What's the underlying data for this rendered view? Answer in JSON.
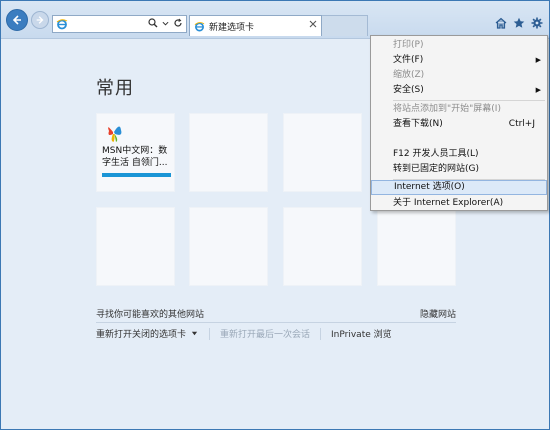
{
  "tab": {
    "title": "新建选项卡"
  },
  "page": {
    "heading": "常用"
  },
  "tiles": [
    {
      "title": "MSN中文网：数字生活 自领门..."
    }
  ],
  "links": {
    "find_sites": "寻找你可能喜欢的其他网站",
    "hide_sites": "隐藏网站",
    "reopen_tabs": "重新打开关闭的选项卡",
    "reopen_session": "重新打开最后一次会话",
    "inprivate": "InPrivate 浏览"
  },
  "menu": {
    "items": [
      {
        "label": "打印(P)",
        "disabled": true
      },
      {
        "label": "文件(F)",
        "submenu": true
      },
      {
        "label": "缩放(Z)",
        "disabled": true
      },
      {
        "label": "安全(S)",
        "submenu": true
      },
      {
        "label": "将站点添加到\"开始\"屏幕(I)",
        "disabled": true
      },
      {
        "label": "查看下载(N)",
        "shortcut": "Ctrl+J"
      },
      {
        "label": "F12 开发人员工具(L)"
      },
      {
        "label": "转到已固定的网站(G)"
      },
      {
        "label": "Internet 选项(O)",
        "highlighted": true
      },
      {
        "label": "关于 Internet Explorer(A)"
      }
    ]
  },
  "colors": {
    "accent": "#1a95d6",
    "nav_back": "#3b7dc0",
    "menu_highlight": "#dce9f8"
  }
}
